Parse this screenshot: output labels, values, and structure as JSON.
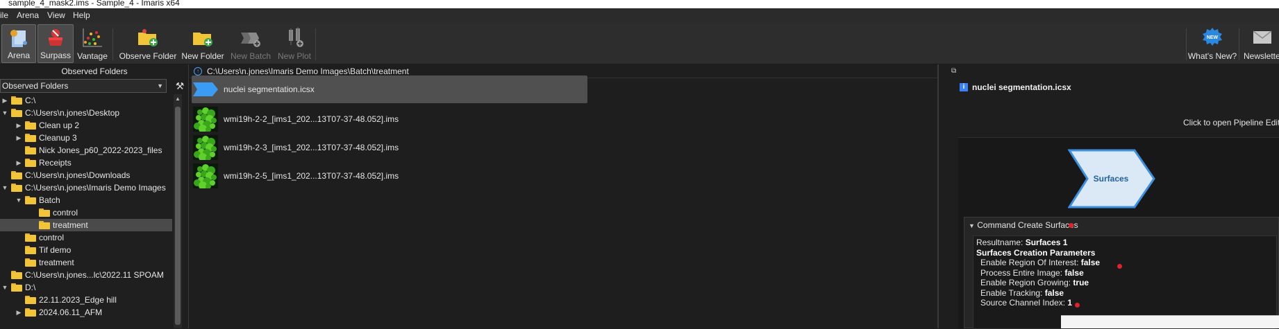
{
  "window": {
    "title": "sample_4_mask2.ims - Sample_4 - Imaris x64"
  },
  "menu": {
    "items": [
      "ile",
      "Arena",
      "View",
      "Help"
    ]
  },
  "toolbar": {
    "arena": "Arena",
    "surpass": "Surpass",
    "vantage": "Vantage",
    "observe_folder": "Observe Folder",
    "new_folder": "New Folder",
    "new_batch": "New Batch",
    "new_plot": "New Plot",
    "whats_new": "What's New?",
    "newsletter": "Newslette"
  },
  "left_panel": {
    "title": "Observed Folders",
    "select_value": "Observed Folders",
    "tree": [
      {
        "label": "C:\\",
        "chev": "▶",
        "indent": 0
      },
      {
        "label": "C:\\Users\\n.jones\\Desktop",
        "chev": "▼",
        "indent": 0
      },
      {
        "label": "Clean up 2",
        "chev": "▶",
        "indent": 1
      },
      {
        "label": "Cleanup 3",
        "chev": "▶",
        "indent": 1
      },
      {
        "label": "Nick Jones_p60_2022-2023_files",
        "chev": "",
        "indent": 1
      },
      {
        "label": "Receipts",
        "chev": "▶",
        "indent": 1
      },
      {
        "label": "C:\\Users\\n.jones\\Downloads",
        "chev": "",
        "indent": 0
      },
      {
        "label": "C:\\Users\\n.jones\\Imaris Demo Images",
        "chev": "▼",
        "indent": 0
      },
      {
        "label": "Batch",
        "chev": "▼",
        "indent": 1
      },
      {
        "label": "control",
        "chev": "",
        "indent": 2
      },
      {
        "label": "treatment",
        "chev": "",
        "indent": 2
      },
      {
        "label": "control",
        "chev": "",
        "indent": 1
      },
      {
        "label": "Tif demo",
        "chev": "",
        "indent": 1
      },
      {
        "label": "treatment",
        "chev": "",
        "indent": 1
      },
      {
        "label": "C:\\Users\\n.jones...lc\\2022.11 SPOAM",
        "chev": "",
        "indent": 0
      },
      {
        "label": "D:\\",
        "chev": "▼",
        "indent": 0
      },
      {
        "label": "22.11.2023_Edge hill",
        "chev": "",
        "indent": 1
      },
      {
        "label": "2024.06.11_AFM",
        "chev": "▶",
        "indent": 1
      }
    ],
    "selected_index": 10
  },
  "middle_panel": {
    "path": "C:\\Users\\n.jones\\Imaris Demo Images\\Batch\\treatment",
    "files": [
      {
        "label": "nuclei segmentation.icsx",
        "type": "pipeline"
      },
      {
        "label": "wmi19h-2-2_[ims1_202...13T07-37-48.052].ims",
        "type": "image"
      },
      {
        "label": "wmi19h-2-3_[ims1_202...13T07-37-48.052].ims",
        "type": "image"
      },
      {
        "label": "wmi19h-2-5_[ims1_202...13T07-37-48.052].ims",
        "type": "image"
      }
    ]
  },
  "right_panel": {
    "title": "nuclei segmentation.icsx",
    "hint": "Click to open Pipeline Edit",
    "node_label": "Surfaces",
    "command_header": "Command Create Surfaces",
    "params": {
      "resultname_label": "Resultname: ",
      "resultname_value": "Surfaces 1",
      "section": "Surfaces Creation Parameters",
      "roi_label": "Enable Region Of Interest: ",
      "roi_value": "false",
      "entire_label": "Process Entire Image: ",
      "entire_value": "false",
      "growing_label": "Enable Region Growing: ",
      "growing_value": "true",
      "tracking_label": "Enable Tracking: ",
      "tracking_value": "false",
      "channel_label": "Source Channel Index: ",
      "channel_value": "1"
    }
  },
  "colors": {
    "accent": "#4aa3ff",
    "folder": "#f2c438",
    "node_fill": "#dbe9f7",
    "node_border": "#3d8fe0",
    "dot": "#e0222a"
  }
}
